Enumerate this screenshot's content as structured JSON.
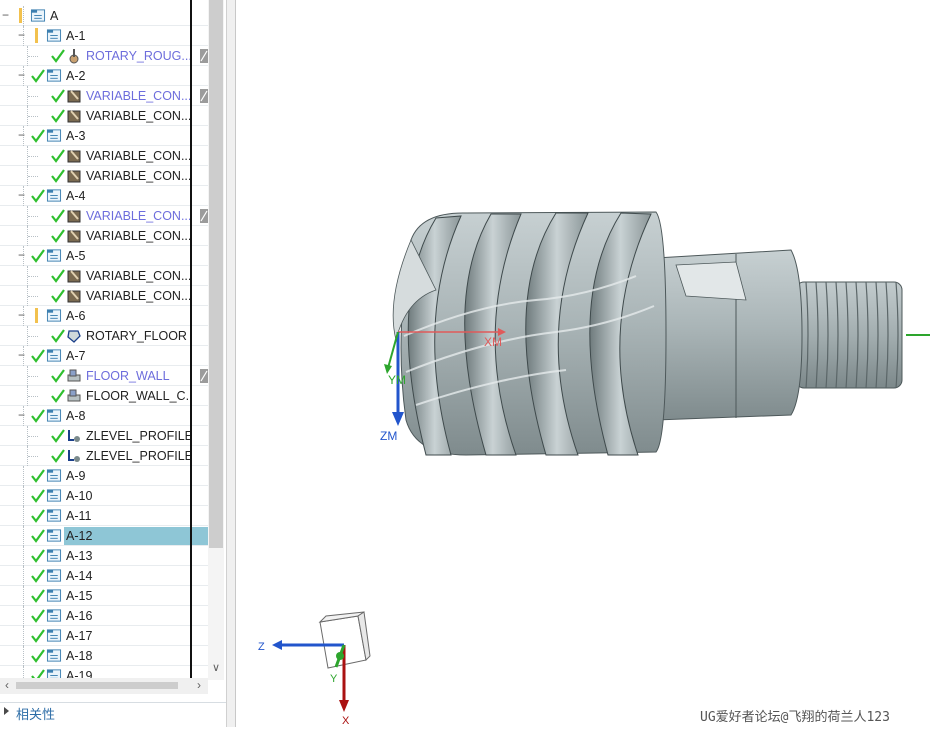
{
  "navigator": {
    "rows": [
      {
        "label": "A",
        "depth": 0,
        "toggle": "−",
        "check": false,
        "lock": true,
        "kind": "folder",
        "blue": false
      },
      {
        "label": "A-1",
        "depth": 1,
        "toggle": "−",
        "check": false,
        "lock": true,
        "kind": "folder",
        "blue": false
      },
      {
        "label": "ROTARY_ROUG...",
        "depth": 2,
        "toggle": "",
        "check": true,
        "lock": false,
        "kind": "op-rough",
        "blue": true,
        "badge": true
      },
      {
        "label": "A-2",
        "depth": 1,
        "toggle": "−",
        "check": true,
        "lock": false,
        "kind": "folder",
        "blue": false
      },
      {
        "label": "VARIABLE_CON...",
        "depth": 2,
        "toggle": "",
        "check": true,
        "lock": false,
        "kind": "op-var",
        "blue": true,
        "badge": true
      },
      {
        "label": "VARIABLE_CON...",
        "depth": 2,
        "toggle": "",
        "check": true,
        "lock": false,
        "kind": "op-var",
        "blue": false
      },
      {
        "label": "A-3",
        "depth": 1,
        "toggle": "−",
        "check": true,
        "lock": false,
        "kind": "folder",
        "blue": false
      },
      {
        "label": "VARIABLE_CON...",
        "depth": 2,
        "toggle": "",
        "check": true,
        "lock": false,
        "kind": "op-var",
        "blue": false
      },
      {
        "label": "VARIABLE_CON...",
        "depth": 2,
        "toggle": "",
        "check": true,
        "lock": false,
        "kind": "op-var",
        "blue": false
      },
      {
        "label": "A-4",
        "depth": 1,
        "toggle": "−",
        "check": true,
        "lock": false,
        "kind": "folder",
        "blue": false
      },
      {
        "label": "VARIABLE_CON...",
        "depth": 2,
        "toggle": "",
        "check": true,
        "lock": false,
        "kind": "op-var",
        "blue": true,
        "badge": true
      },
      {
        "label": "VARIABLE_CON...",
        "depth": 2,
        "toggle": "",
        "check": true,
        "lock": false,
        "kind": "op-var",
        "blue": false
      },
      {
        "label": "A-5",
        "depth": 1,
        "toggle": "−",
        "check": true,
        "lock": false,
        "kind": "folder",
        "blue": false
      },
      {
        "label": "VARIABLE_CON...",
        "depth": 2,
        "toggle": "",
        "check": true,
        "lock": false,
        "kind": "op-var",
        "blue": false
      },
      {
        "label": "VARIABLE_CON...",
        "depth": 2,
        "toggle": "",
        "check": true,
        "lock": false,
        "kind": "op-var",
        "blue": false
      },
      {
        "label": "A-6",
        "depth": 1,
        "toggle": "−",
        "check": false,
        "lock": true,
        "kind": "folder",
        "blue": false
      },
      {
        "label": "ROTARY_FLOOR",
        "depth": 2,
        "toggle": "",
        "check": true,
        "lock": false,
        "kind": "op-floor",
        "blue": false
      },
      {
        "label": "A-7",
        "depth": 1,
        "toggle": "−",
        "check": true,
        "lock": false,
        "kind": "folder",
        "blue": false
      },
      {
        "label": "FLOOR_WALL",
        "depth": 2,
        "toggle": "",
        "check": true,
        "lock": false,
        "kind": "op-fw",
        "blue": true,
        "badge": true
      },
      {
        "label": "FLOOR_WALL_C...",
        "depth": 2,
        "toggle": "",
        "check": true,
        "lock": false,
        "kind": "op-fw",
        "blue": false
      },
      {
        "label": "A-8",
        "depth": 1,
        "toggle": "−",
        "check": true,
        "lock": false,
        "kind": "folder",
        "blue": false
      },
      {
        "label": "ZLEVEL_PROFILE...",
        "depth": 2,
        "toggle": "",
        "check": true,
        "lock": false,
        "kind": "op-z",
        "blue": false
      },
      {
        "label": "ZLEVEL_PROFILE...",
        "depth": 2,
        "toggle": "",
        "check": true,
        "lock": false,
        "kind": "op-z",
        "blue": false
      },
      {
        "label": "A-9",
        "depth": 1,
        "toggle": "",
        "check": true,
        "lock": false,
        "kind": "folder",
        "blue": false
      },
      {
        "label": "A-10",
        "depth": 1,
        "toggle": "",
        "check": true,
        "lock": false,
        "kind": "folder",
        "blue": false
      },
      {
        "label": "A-11",
        "depth": 1,
        "toggle": "",
        "check": true,
        "lock": false,
        "kind": "folder",
        "blue": false
      },
      {
        "label": "A-12",
        "depth": 1,
        "toggle": "",
        "check": true,
        "lock": false,
        "kind": "folder",
        "blue": false,
        "selected": true
      },
      {
        "label": "A-13",
        "depth": 1,
        "toggle": "",
        "check": true,
        "lock": false,
        "kind": "folder",
        "blue": false
      },
      {
        "label": "A-14",
        "depth": 1,
        "toggle": "",
        "check": true,
        "lock": false,
        "kind": "folder",
        "blue": false
      },
      {
        "label": "A-15",
        "depth": 1,
        "toggle": "",
        "check": true,
        "lock": false,
        "kind": "folder",
        "blue": false
      },
      {
        "label": "A-16",
        "depth": 1,
        "toggle": "",
        "check": true,
        "lock": false,
        "kind": "folder",
        "blue": false
      },
      {
        "label": "A-17",
        "depth": 1,
        "toggle": "",
        "check": true,
        "lock": false,
        "kind": "folder",
        "blue": false
      },
      {
        "label": "A-18",
        "depth": 1,
        "toggle": "",
        "check": true,
        "lock": false,
        "kind": "folder",
        "blue": false
      },
      {
        "label": "A-19",
        "depth": 1,
        "toggle": "",
        "check": true,
        "lock": false,
        "kind": "folder",
        "blue": false
      }
    ],
    "dependencies_label": "相关性"
  },
  "viewport": {
    "model_csys": {
      "x_label": "XM",
      "y_label": "YM",
      "z_label": "ZM"
    },
    "triad": {
      "z_label": "Z",
      "y_label": "Y",
      "x_label": "X"
    },
    "watermark": "UG爱好者论坛@飞翔的荷兰人123"
  },
  "colors": {
    "check": "#2fbf2f",
    "selected": "#8ec6d6",
    "op_blue": "#6d6ddc",
    "model": "#a9b4b6",
    "axis_x": "#e05a5a",
    "axis_y": "#2da52d",
    "axis_z": "#2255cc",
    "triad_x": "#aa1111"
  }
}
